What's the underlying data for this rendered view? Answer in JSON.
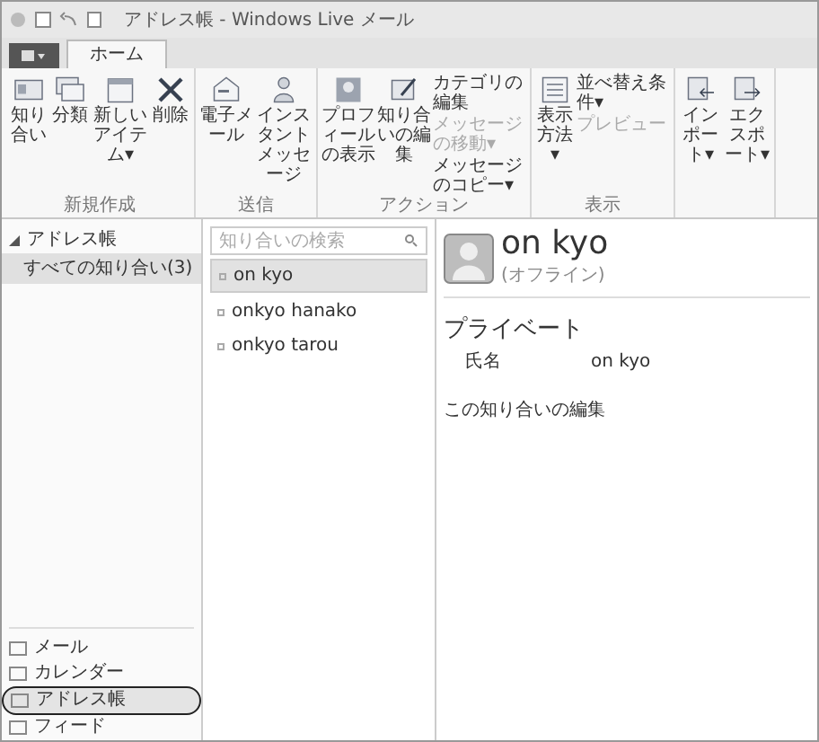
{
  "window": {
    "title": "アドレス帳 - Windows Live メール"
  },
  "tabs": [
    {
      "label": "ホーム",
      "selected": true
    }
  ],
  "ribbon": {
    "groups": [
      {
        "label": "新規作成",
        "buttons": [
          {
            "label": "知り合い"
          },
          {
            "label": "分類"
          },
          {
            "label": "新しいアイテム▾"
          },
          {
            "label": "削除"
          }
        ]
      },
      {
        "label": "送信",
        "buttons": [
          {
            "label": "電子メール"
          },
          {
            "label": "インスタントメッセージ"
          }
        ]
      },
      {
        "label": "アクション",
        "buttons": [
          {
            "label": "プロフィールの表示"
          },
          {
            "label": "知り合いの編集"
          }
        ],
        "small": [
          {
            "label": "カテゴリの編集",
            "disabled": false
          },
          {
            "label": "メッセージの移動▾",
            "disabled": true
          },
          {
            "label": "メッセージのコピー▾",
            "disabled": false
          }
        ]
      },
      {
        "label": "表示",
        "buttons": [
          {
            "label": "表示方法▾"
          }
        ],
        "small": [
          {
            "label": "並べ替え条件▾",
            "disabled": false
          },
          {
            "label": "プレビュー",
            "disabled": true
          }
        ]
      },
      {
        "buttons": [
          {
            "label": "インポート▾"
          },
          {
            "label": "エクスポート▾"
          }
        ]
      }
    ]
  },
  "folders": {
    "header": "アドレス帳",
    "expanded": true,
    "items": [
      {
        "label": "すべての知り合い(3)",
        "selected": true
      }
    ]
  },
  "nav": [
    {
      "label": "メール",
      "selected": false
    },
    {
      "label": "カレンダー",
      "selected": false
    },
    {
      "label": "アドレス帳",
      "selected": true
    },
    {
      "label": "フィード",
      "selected": false
    }
  ],
  "search": {
    "placeholder": "知り合いの検索"
  },
  "contacts": [
    {
      "name": "on kyo",
      "selected": true
    },
    {
      "name": "onkyo hanako",
      "selected": false
    },
    {
      "name": "onkyo tarou",
      "selected": false
    }
  ],
  "detail": {
    "name": "on kyo",
    "status": "(オフライン)",
    "section": "プライベート",
    "fields": [
      {
        "label": "氏名",
        "value": "on kyo"
      }
    ],
    "edit_link": "この知り合いの編集"
  }
}
